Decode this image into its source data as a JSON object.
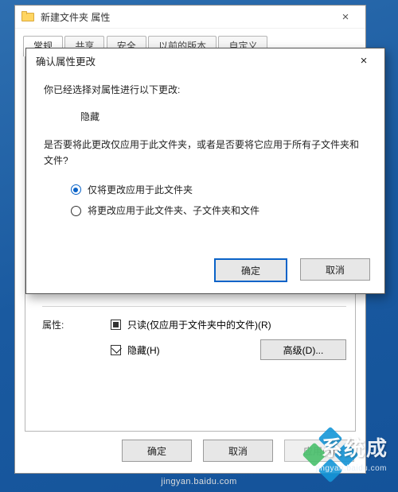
{
  "propwin": {
    "title": "新建文件夹 属性",
    "tabs": [
      "常规",
      "共享",
      "安全",
      "以前的版本",
      "自定义"
    ],
    "attributes_label": "属性:",
    "readonly_label": "只读(仅应用于文件夹中的文件)(R)",
    "hidden_label": "隐藏(H)",
    "advanced_btn": "高级(D)...",
    "buttons": {
      "ok": "确定",
      "cancel": "取消",
      "apply": "应用(A)"
    }
  },
  "modal": {
    "title": "确认属性更改",
    "intro": "你已经选择对属性进行以下更改:",
    "change": "隐藏",
    "question": "是否要将此更改仅应用于此文件夹，或者是否要将它应用于所有子文件夹和文件?",
    "opt1": "仅将更改应用于此文件夹",
    "opt2": "将更改应用于此文件夹、子文件夹和文件",
    "ok": "确定",
    "cancel": "取消"
  },
  "watermark": {
    "brand": "系统成",
    "url": "jingyan.baidu.com"
  }
}
